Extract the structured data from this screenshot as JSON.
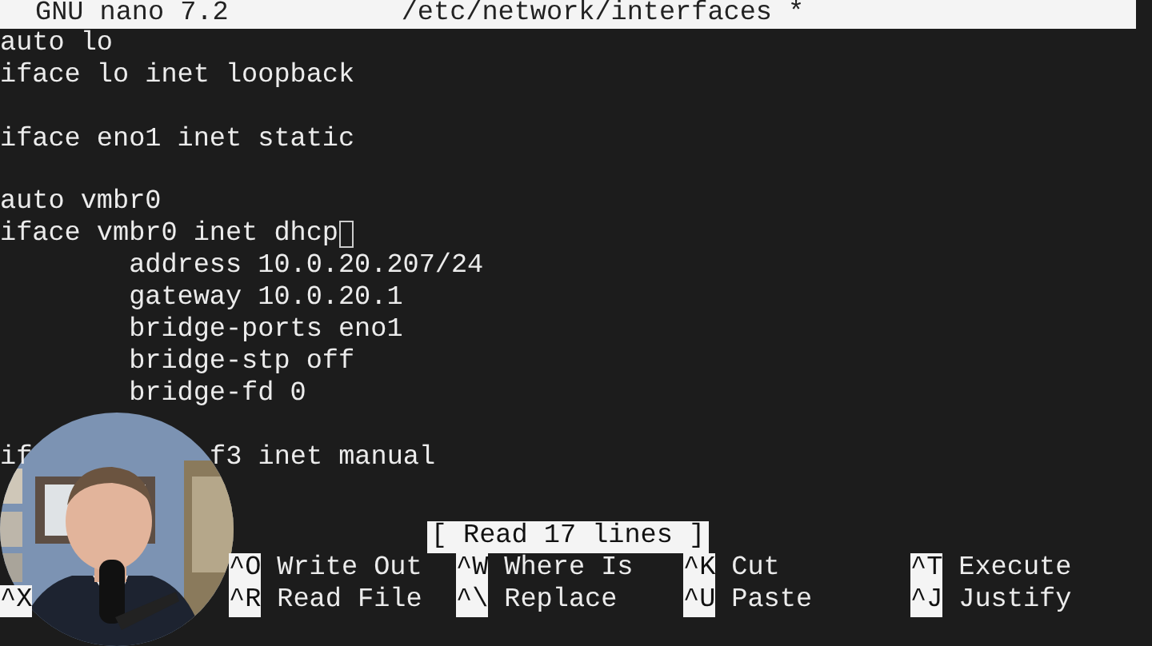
{
  "title_bar": {
    "app": "GNU nano 7.2",
    "file": "/etc/network/interfaces *"
  },
  "lines": [
    {
      "kind": "text",
      "text": "auto lo",
      "cursor": false
    },
    {
      "kind": "text",
      "text": "iface lo inet loopback",
      "cursor": false
    },
    {
      "kind": "blank"
    },
    {
      "kind": "text",
      "text": "iface eno1 inet static",
      "cursor": false
    },
    {
      "kind": "blank"
    },
    {
      "kind": "text",
      "text": "auto vmbr0",
      "cursor": false
    },
    {
      "kind": "text",
      "text": "iface vmbr0 inet dhcp",
      "cursor": true
    },
    {
      "kind": "text",
      "text": "        address 10.0.20.207/24",
      "cursor": false
    },
    {
      "kind": "text",
      "text": "        gateway 10.0.20.1",
      "cursor": false
    },
    {
      "kind": "text",
      "text": "        bridge-ports eno1",
      "cursor": false
    },
    {
      "kind": "text",
      "text": "        bridge-stp off",
      "cursor": false
    },
    {
      "kind": "text",
      "text": "        bridge-fd 0",
      "cursor": false
    },
    {
      "kind": "blank"
    },
    {
      "kind": "split",
      "parts": [
        "if",
        "f3 inet manual"
      ]
    }
  ],
  "status": "[ Read 17 lines ]",
  "shortcut_rows": [
    [
      {
        "key": "^O",
        "label": "Write Out"
      },
      {
        "key": "^W",
        "label": "Where Is"
      },
      {
        "key": "^K",
        "label": "Cut"
      },
      {
        "key": "^T",
        "label": "Execute"
      }
    ],
    [
      {
        "key": "^X"
      },
      {
        "key": "^R",
        "label": "Read File"
      },
      {
        "key": "^\\",
        "label": "Replace"
      },
      {
        "key": "^U",
        "label": "Paste"
      },
      {
        "key": "^J",
        "label": "Justify"
      }
    ]
  ],
  "webcam": {
    "kind": "picture"
  }
}
